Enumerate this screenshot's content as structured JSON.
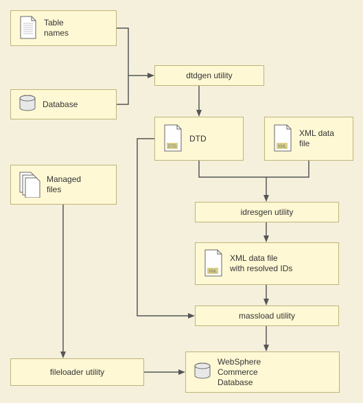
{
  "colors": {
    "boxFill": "#fff8d5",
    "boxStroke": "#bfb37a",
    "bg": "#f5f0dc"
  },
  "nodes": {
    "tableNames": {
      "label": "Table\nnames",
      "icon": "text-file-icon"
    },
    "database": {
      "label": "Database",
      "icon": "database-icon"
    },
    "managedFiles": {
      "label": "Managed\nfiles",
      "icon": "files-icon"
    },
    "dtdgen": {
      "label": "dtdgen utility"
    },
    "dtd": {
      "label": "DTD",
      "icon": "dtd-file-icon"
    },
    "xmlData": {
      "label": "XML data\nfile",
      "icon": "xml-file-icon"
    },
    "idresgen": {
      "label": "idresgen utility"
    },
    "xmlResolved": {
      "label": "XML data file\nwith resolved IDs",
      "icon": "xml-file-icon"
    },
    "massload": {
      "label": "massload utility"
    },
    "fileloader": {
      "label": "fileloader utility"
    },
    "wscDb": {
      "label": "WebSphere\nCommerce\nDatabase",
      "icon": "database-icon"
    }
  },
  "chart_data": {
    "type": "flow-diagram",
    "title": "",
    "nodes": [
      {
        "id": "tableNames",
        "label": "Table names",
        "kind": "artifact"
      },
      {
        "id": "database",
        "label": "Database",
        "kind": "datastore"
      },
      {
        "id": "managedFiles",
        "label": "Managed files",
        "kind": "artifact"
      },
      {
        "id": "dtdgen",
        "label": "dtdgen utility",
        "kind": "process"
      },
      {
        "id": "dtd",
        "label": "DTD",
        "kind": "artifact"
      },
      {
        "id": "xmlData",
        "label": "XML data file",
        "kind": "artifact"
      },
      {
        "id": "idresgen",
        "label": "idresgen utility",
        "kind": "process"
      },
      {
        "id": "xmlResolved",
        "label": "XML data file with resolved IDs",
        "kind": "artifact"
      },
      {
        "id": "massload",
        "label": "massload utility",
        "kind": "process"
      },
      {
        "id": "fileloader",
        "label": "fileloader utility",
        "kind": "process"
      },
      {
        "id": "wscDb",
        "label": "WebSphere Commerce Database",
        "kind": "datastore"
      }
    ],
    "edges": [
      {
        "from": "tableNames",
        "to": "dtdgen"
      },
      {
        "from": "database",
        "to": "dtdgen"
      },
      {
        "from": "dtdgen",
        "to": "dtd"
      },
      {
        "from": "dtd",
        "to": "idresgen"
      },
      {
        "from": "xmlData",
        "to": "idresgen"
      },
      {
        "from": "idresgen",
        "to": "xmlResolved"
      },
      {
        "from": "xmlResolved",
        "to": "massload"
      },
      {
        "from": "dtd",
        "to": "massload"
      },
      {
        "from": "massload",
        "to": "wscDb"
      },
      {
        "from": "managedFiles",
        "to": "fileloader"
      },
      {
        "from": "fileloader",
        "to": "wscDb"
      }
    ]
  }
}
